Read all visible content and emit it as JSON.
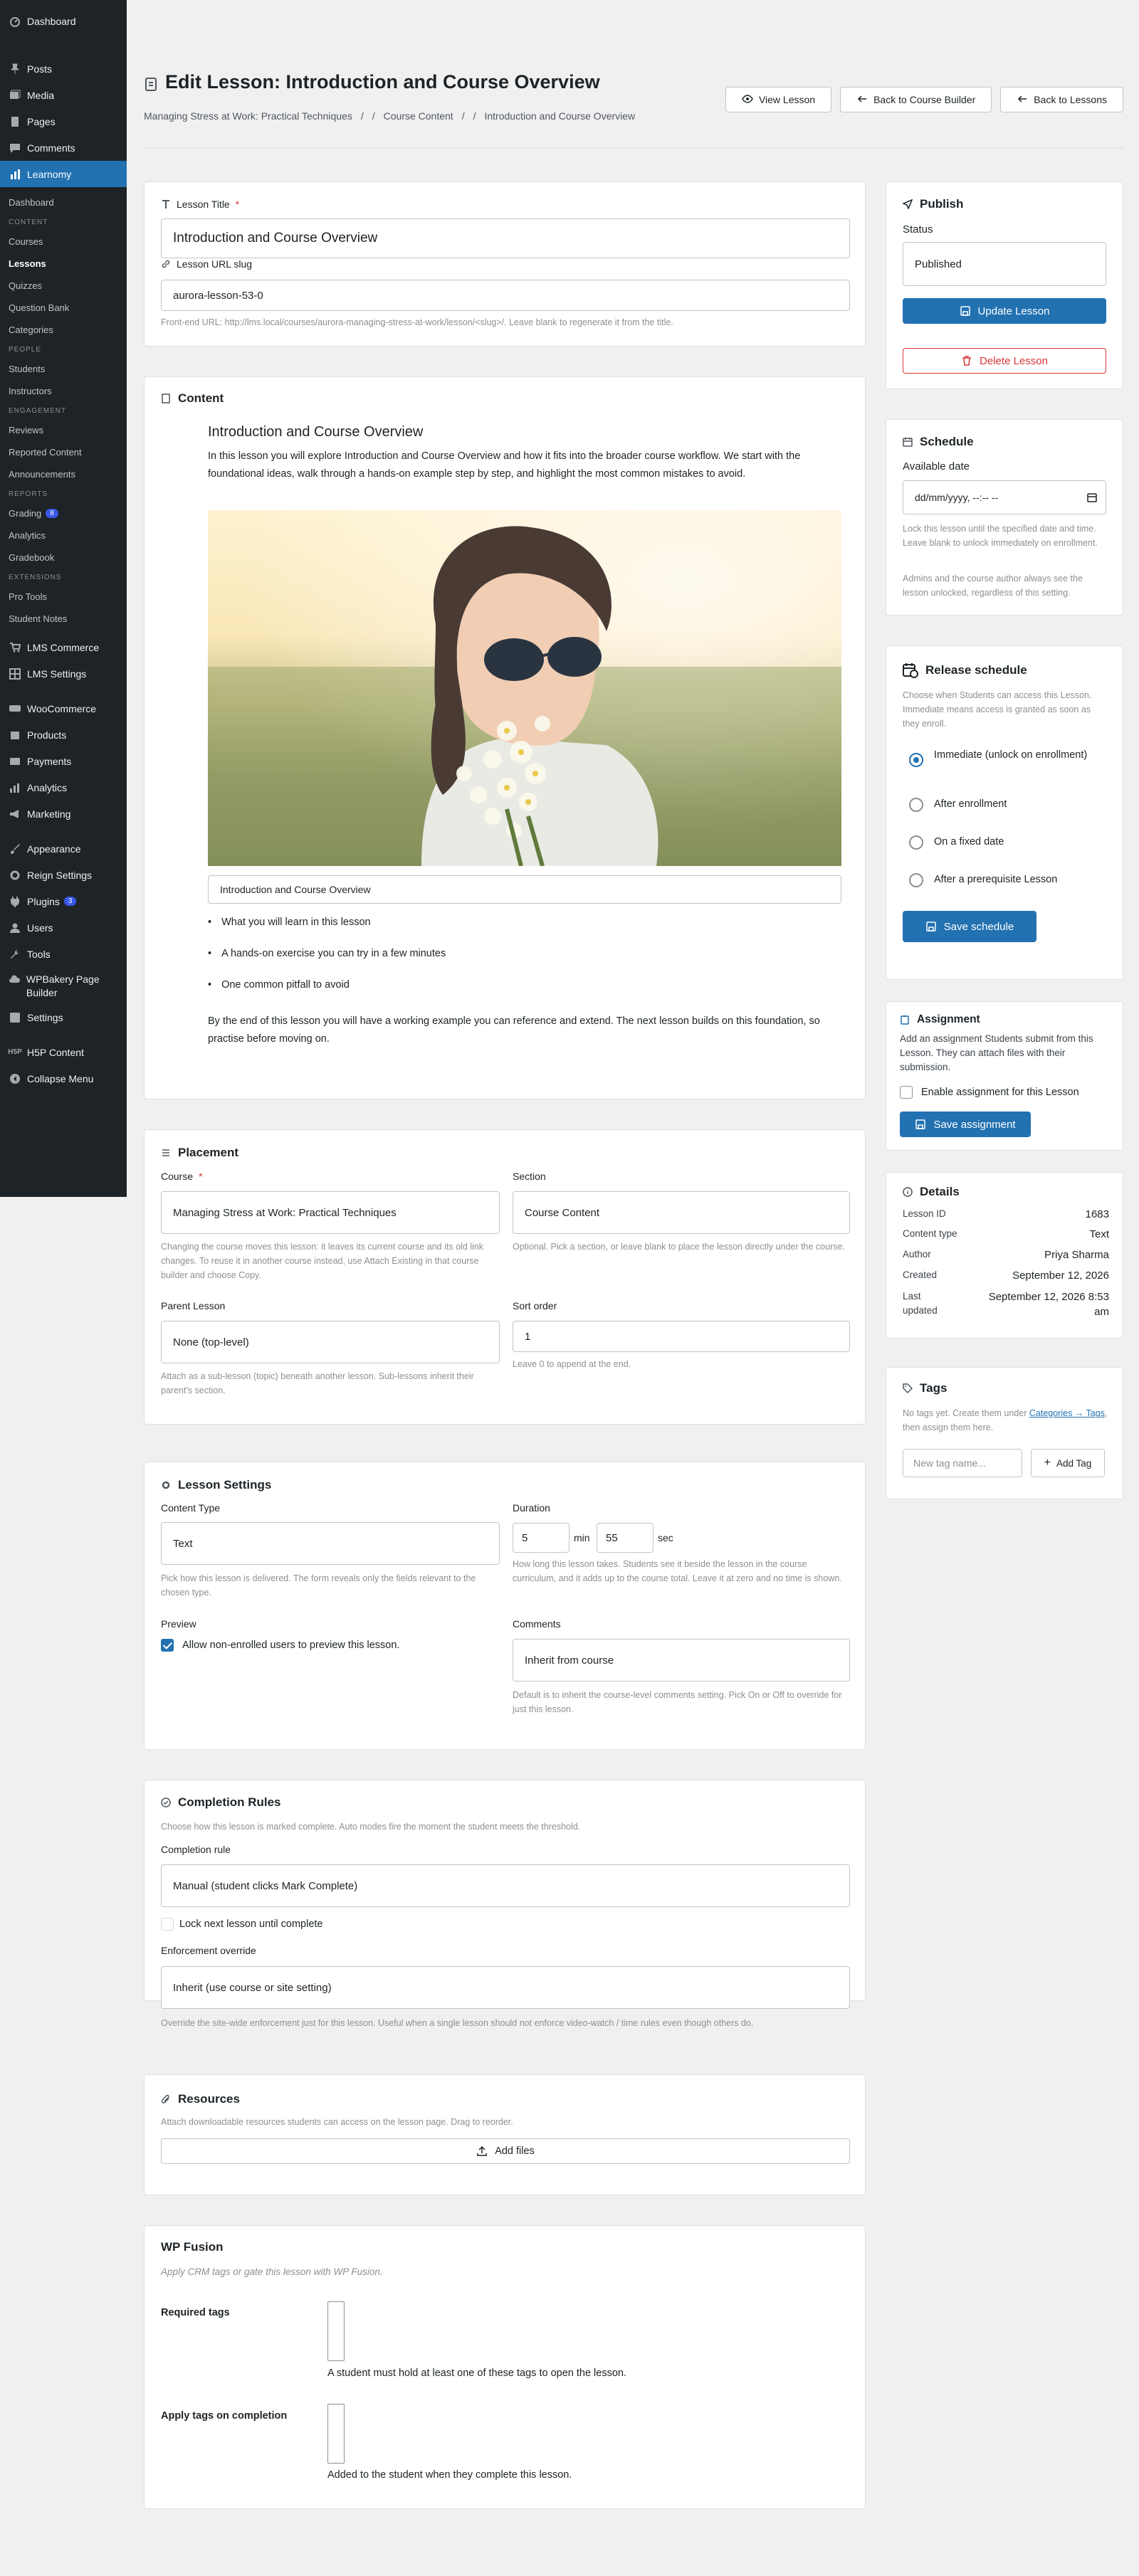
{
  "sidebar": {
    "top": [
      {
        "label": "Dashboard",
        "icon": "dashboard-icon"
      }
    ],
    "main": [
      {
        "label": "Posts",
        "icon": "pin-icon"
      },
      {
        "label": "Media",
        "icon": "media-icon"
      },
      {
        "label": "Pages",
        "icon": "pages-icon"
      },
      {
        "label": "Comments",
        "icon": "comments-icon"
      },
      {
        "label": "Learnomy",
        "icon": "chart-icon"
      }
    ],
    "learnomy_sub": {
      "dashboard": "Dashboard",
      "sec_content": "CONTENT",
      "courses": "Courses",
      "lessons": "Lessons",
      "quizzes": "Quizzes",
      "question_bank": "Question Bank",
      "categories": "Categories",
      "sec_people": "PEOPLE",
      "students": "Students",
      "instructors": "Instructors",
      "sec_engagement": "ENGAGEMENT",
      "reviews": "Reviews",
      "reported": "Reported Content",
      "announcements": "Announcements",
      "sec_reports": "REPORTS",
      "grading": "Grading",
      "grading_badge": "8",
      "analytics": "Analytics",
      "gradebook": "Gradebook",
      "sec_extensions": "EXTENSIONS",
      "pro_tools": "Pro Tools",
      "student_notes": "Student Notes"
    },
    "bottom": {
      "lms_commerce": "LMS Commerce",
      "lms_settings": "LMS Settings",
      "woocommerce": "WooCommerce",
      "products": "Products",
      "payments": "Payments",
      "analytics": "Analytics",
      "marketing": "Marketing",
      "appearance": "Appearance",
      "reign": "Reign Settings",
      "plugins": "Plugins",
      "plugins_badge": "3",
      "users": "Users",
      "tools": "Tools",
      "wpbakery": "WPBakery Page Builder",
      "settings": "Settings",
      "h5p": "H5P Content",
      "collapse": "Collapse Menu"
    }
  },
  "header": {
    "title": "Edit Lesson: Introduction and Course Overview",
    "breadcrumb": [
      "Managing Stress at Work: Practical Techniques",
      "Course Content",
      "Introduction and Course Overview"
    ],
    "view": "View Lesson",
    "back_builder": "Back to Course Builder",
    "back_lessons": "Back to Lessons"
  },
  "title_card": {
    "title_label": "Lesson Title",
    "title_value": "Introduction and Course Overview",
    "slug_label": "Lesson URL slug",
    "slug_value": "aurora-lesson-53-0",
    "slug_help": "Front-end URL: http://lms.local/courses/aurora-managing-stress-at-work/lesson/<slug>/. Leave blank to regenerate it from the title."
  },
  "content_card": {
    "heading": "Content",
    "lesson_heading": "Introduction and Course Overview",
    "intro": "In this lesson you will explore Introduction and Course Overview and how it fits into the broader course workflow. We start with the foundational ideas, walk through a hands-on example step by step, and highlight the most common mistakes to avoid.",
    "caption": "Introduction and Course Overview",
    "bullets": [
      "What you will learn in this lesson",
      "A hands-on exercise you can try in a few minutes",
      "One common pitfall to avoid"
    ],
    "outro": "By the end of this lesson you will have a working example you can reference and extend. The next lesson builds on this foundation, so practise before moving on."
  },
  "placement": {
    "heading": "Placement",
    "course_label": "Course",
    "course_value": "Managing Stress at Work: Practical Techniques",
    "course_help": "Changing the course moves this lesson: it leaves its current course and its old link changes. To reuse it in another course instead, use Attach Existing in that course builder and choose Copy.",
    "section_label": "Section",
    "section_value": "Course Content",
    "section_help": "Optional. Pick a section, or leave blank to place the lesson directly under the course.",
    "parent_label": "Parent Lesson",
    "parent_value": "None (top-level)",
    "parent_help": "Attach as a sub-lesson (topic) beneath another lesson. Sub-lessons inherit their parent's section.",
    "sort_label": "Sort order",
    "sort_value": "1",
    "sort_help": "Leave 0 to append at the end."
  },
  "settings": {
    "heading": "Lesson Settings",
    "ctype_label": "Content Type",
    "ctype_value": "Text",
    "ctype_help": "Pick how this lesson is delivered. The form reveals only the fields relevant to the chosen type.",
    "dur_label": "Duration",
    "dur_min": "5",
    "dur_min_unit": "min",
    "dur_sec": "55",
    "dur_sec_unit": "sec",
    "dur_help": "How long this lesson takes. Students see it beside the lesson in the course curriculum, and it adds up to the course total. Leave it at zero and no time is shown.",
    "preview_label": "Preview",
    "preview_check": "Allow non-enrolled users to preview this lesson.",
    "comments_label": "Comments",
    "comments_value": "Inherit from course",
    "comments_help": "Default is to inherit the course-level comments setting. Pick On or Off to override for just this lesson."
  },
  "completion": {
    "heading": "Completion Rules",
    "sub": "Choose how this lesson is marked complete. Auto modes fire the moment the student meets the threshold.",
    "rule_label": "Completion rule",
    "rule_value": "Manual (student clicks Mark Complete)",
    "lock_label": "Lock next lesson until complete",
    "enf_label": "Enforcement override",
    "enf_value": "Inherit (use course or site setting)",
    "enf_help": "Override the site-wide enforcement just for this lesson. Useful when a single lesson should not enforce video-watch / time rules even though others do."
  },
  "resources": {
    "heading": "Resources",
    "sub": "Attach downloadable resources students can access on the lesson page. Drag to reorder.",
    "add": "Add files"
  },
  "wpfusion": {
    "heading": "WP Fusion",
    "sub": "Apply CRM tags or gate this lesson with WP Fusion.",
    "req_label": "Required tags",
    "req_help": "A student must hold at least one of these tags to open the lesson.",
    "apply_label": "Apply tags on completion",
    "apply_help": "Added to the student when they complete this lesson."
  },
  "publish": {
    "heading": "Publish",
    "status_label": "Status",
    "status_value": "Published",
    "update": "Update Lesson",
    "delete": "Delete Lesson"
  },
  "schedule": {
    "heading": "Schedule",
    "avail_label": "Available date",
    "avail_placeholder": "dd/mm/yyyy, --:-- --",
    "help1": "Lock this lesson until the specified date and time. Leave blank to unlock immediately on enrollment.",
    "help2": "Admins and the course author always see the lesson unlocked, regardless of this setting."
  },
  "release": {
    "heading": "Release schedule",
    "help": "Choose when Students can access this Lesson. Immediate means access is granted as soon as they enroll.",
    "options": [
      "Immediate (unlock on enrollment)",
      "After enrollment",
      "On a fixed date",
      "After a prerequisite Lesson"
    ],
    "selected": 0,
    "save": "Save schedule"
  },
  "assignment": {
    "heading": "Assignment",
    "help": "Add an assignment Students submit from this Lesson. They can attach files with their submission.",
    "enable": "Enable assignment for this Lesson",
    "save": "Save assignment"
  },
  "details": {
    "heading": "Details",
    "rows": [
      {
        "k": "Lesson ID",
        "v": "1683"
      },
      {
        "k": "Content type",
        "v": "Text"
      },
      {
        "k": "Author",
        "v": "Priya Sharma"
      },
      {
        "k": "Created",
        "v": "September 12, 2026"
      },
      {
        "k": "Last updated",
        "v": "September 12, 2026 8:53 am"
      }
    ]
  },
  "tags": {
    "heading": "Tags",
    "help_pre": "No tags yet. Create them under ",
    "help_link": "Categories → Tags",
    "help_post": ", then assign them here.",
    "placeholder": "New tag name...",
    "add": "Add Tag"
  },
  "colors": {
    "accent": "#2271b1",
    "danger": "#d63638",
    "sidebar": "#1d2327"
  }
}
